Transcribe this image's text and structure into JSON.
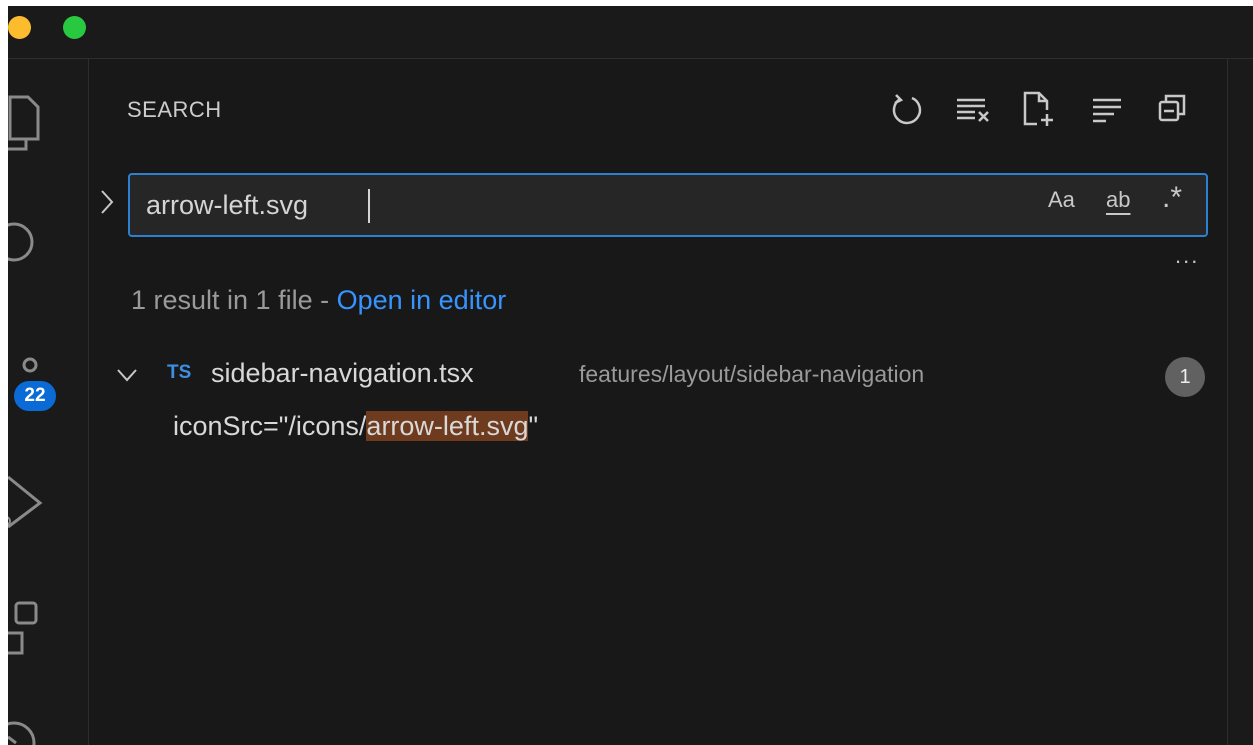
{
  "colors": {
    "accent": "#2d7fd0",
    "link": "#3794ff",
    "badge": "#0a6bd6",
    "match_highlight": "#6f3b1e",
    "ts_icon": "#3d8fe3"
  },
  "activity_bar": {
    "icons": [
      "explorer-icon",
      "search-icon",
      "source-control-icon",
      "run-debug-icon",
      "extensions-icon",
      "remote-icon"
    ],
    "source_control_badge": "22"
  },
  "search": {
    "title": "SEARCH",
    "toolbar": [
      "refresh-icon",
      "clear-results-icon",
      "new-search-editor-icon",
      "view-as-tree-icon",
      "collapse-all-icon"
    ],
    "query": "arrow-left.svg",
    "options": {
      "match_case": "Aa",
      "whole_word": "ab",
      "regex": ".*"
    },
    "more": "...",
    "summary_prefix": "1 result in 1 file - ",
    "open_in_editor": "Open in editor",
    "results": [
      {
        "lang": "TS",
        "file": "sidebar-navigation.tsx",
        "path": "features/layout/sidebar-navigation",
        "count": "1",
        "match_before": "iconSrc=\"/icons/",
        "match_text": "arrow-left.svg",
        "match_after": "\""
      }
    ]
  }
}
